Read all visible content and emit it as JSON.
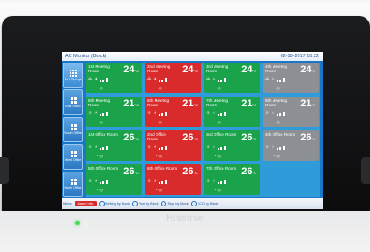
{
  "device": {
    "brand": "Hisense"
  },
  "screen": {
    "title": "AC Monitor (Block)",
    "datetime": "02-10-2017 10:22"
  },
  "sidebar": {
    "items": [
      {
        "label": "ALL Groups",
        "active": true
      },
      {
        "label": "East Office"
      },
      {
        "label": "South Office"
      },
      {
        "label": "West Office"
      },
      {
        "label": "North Office"
      }
    ]
  },
  "tiles": [
    {
      "name": "1st Meeting Room",
      "temp": "24",
      "unit": "°C",
      "state": "green"
    },
    {
      "name": "2nd Meeting Room",
      "temp": "24",
      "unit": "°C",
      "state": "red"
    },
    {
      "name": "3rd Meeting Room",
      "temp": "24",
      "unit": "°C",
      "state": "green"
    },
    {
      "name": "4th Meeting Room",
      "temp": "24",
      "unit": "°C",
      "state": "gray"
    },
    {
      "name": "5th Meeting Room",
      "temp": "21",
      "unit": "°C",
      "state": "green"
    },
    {
      "name": "6th Meeting Room",
      "temp": "21",
      "unit": "°C",
      "state": "red"
    },
    {
      "name": "7th Meeting Room",
      "temp": "21",
      "unit": "°C",
      "state": "green"
    },
    {
      "name": "8th Meeting Room",
      "temp": "21",
      "unit": "°C",
      "state": "gray"
    },
    {
      "name": "1st Office Room",
      "temp": "26",
      "unit": "°C",
      "state": "green"
    },
    {
      "name": "2nd Office Room",
      "temp": "26",
      "unit": "°C",
      "state": "red"
    },
    {
      "name": "3rd Office Room",
      "temp": "26",
      "unit": "°C",
      "state": "green"
    },
    {
      "name": "4th Office Room",
      "temp": "26",
      "unit": "°C",
      "state": "gray"
    },
    {
      "name": "5th Office Room",
      "temp": "26",
      "unit": "°C",
      "state": "green"
    },
    {
      "name": "6th Office Room",
      "temp": "26",
      "unit": "°C",
      "state": "red"
    },
    {
      "name": "7th Office Room",
      "temp": "26",
      "unit": "°C",
      "state": "green"
    }
  ],
  "bottombar": {
    "menu": "Menu",
    "alarm": "Alarm Info.",
    "setting": "Setting by Block",
    "run": "Run by Block",
    "stop": "Stop by Block",
    "eco": "ECO by Block"
  },
  "colors": {
    "running": "#1aa34a",
    "alarm": "#d92b2b",
    "stopped": "#8c9094",
    "panel": "#2f9bd9"
  }
}
